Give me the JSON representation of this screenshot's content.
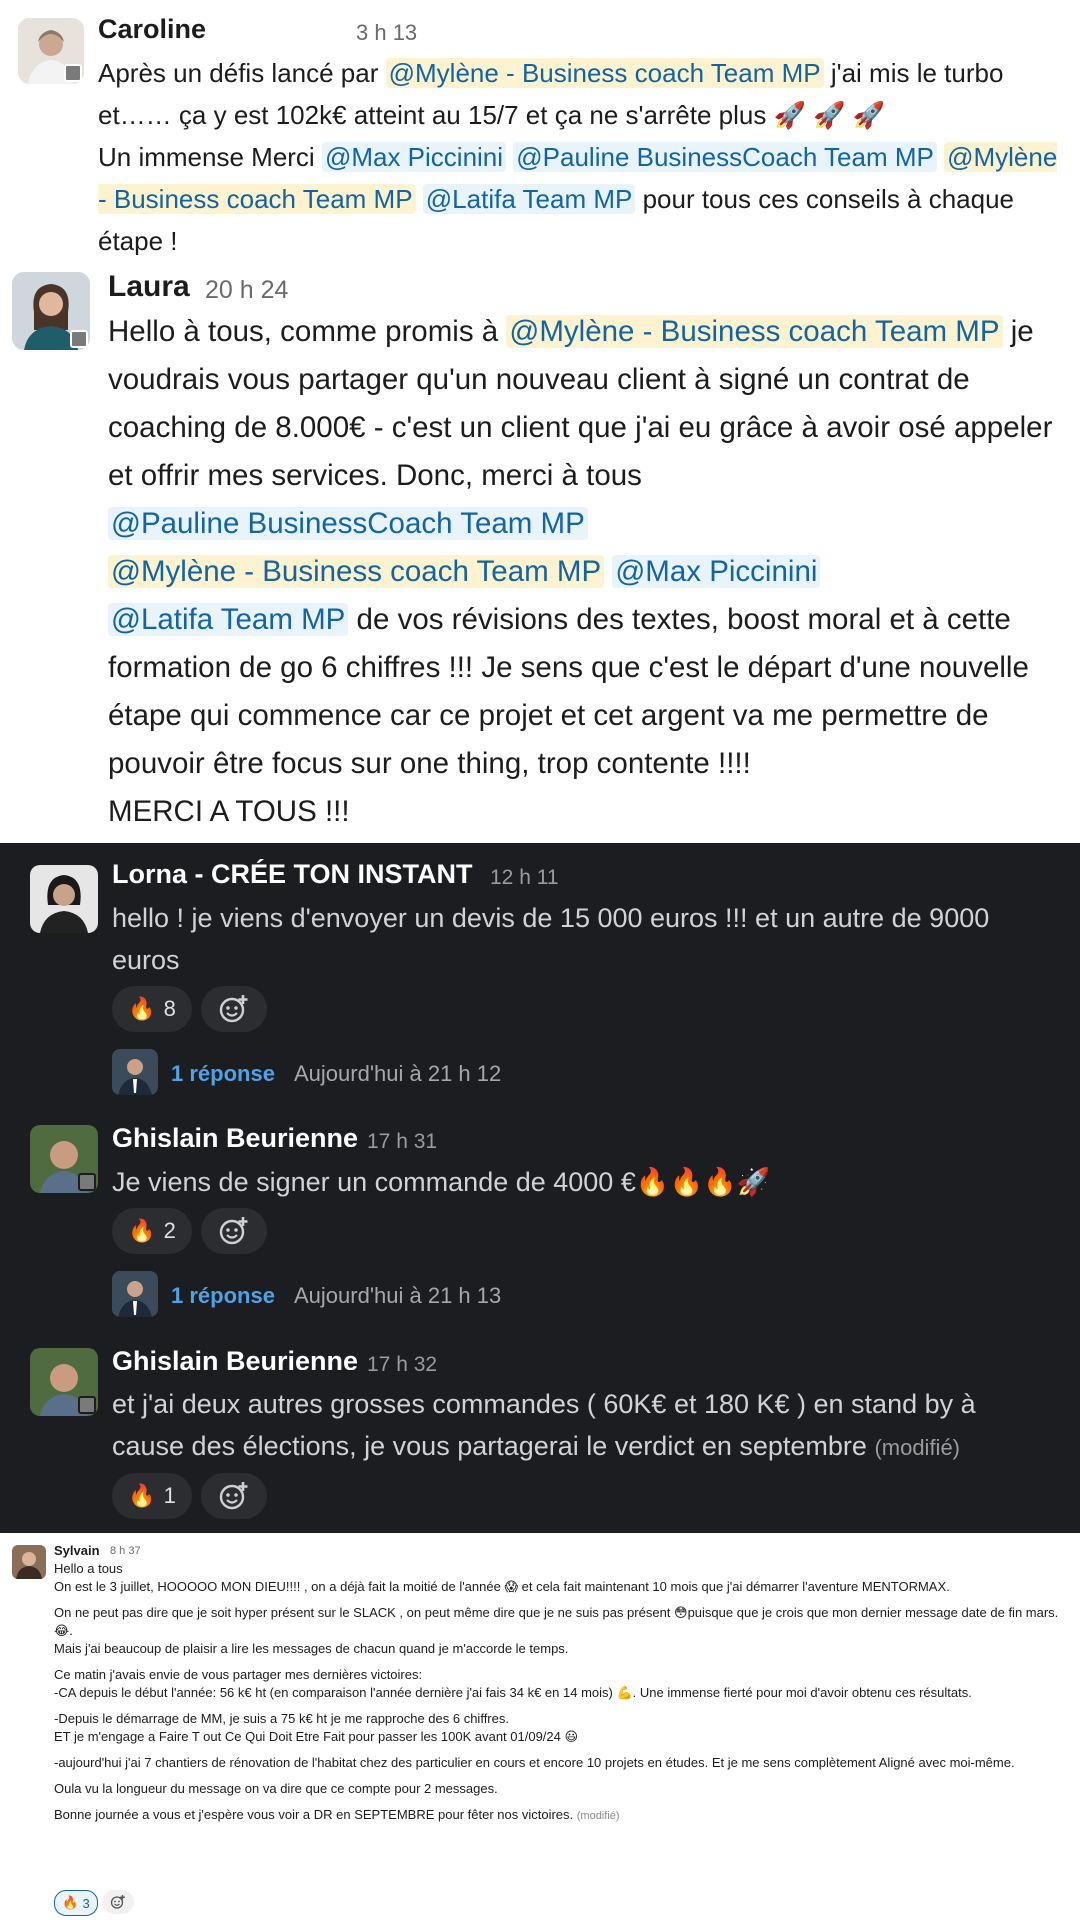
{
  "messages": {
    "caroline": {
      "name": "Caroline",
      "time": "3 h 13",
      "t1": "Après un défis lancé par ",
      "m_mylene": "@Mylène - Business coach Team MP",
      "t2": " j'ai mis le turbo et…… ça y est 102k€ atteint au 15/7 et ça ne s'arrête plus ",
      "rockets": "🚀 🚀 🚀",
      "t3": "Un immense Merci ",
      "m_max": "@Max Piccinini",
      "m_pauline": "@Pauline BusinessCoach Team MP",
      "m_mylene2": "@Mylène - Business coach Team MP",
      "m_latifa": "@Latifa Team MP",
      "t4": " pour tous ces conseils à chaque étape !"
    },
    "laura": {
      "name": "Laura",
      "time": "20 h 24",
      "t1": "Hello à tous, comme promis à ",
      "m_mylene": "@Mylène - Business coach Team MP",
      "t2": " je voudrais vous partager qu'un nouveau client à signé un contrat de coaching de 8.000€ - c'est un client que j'ai eu grâce à avoir osé appeler et offrir mes services. Donc, merci à tous",
      "m_pauline": "@Pauline BusinessCoach Team MP",
      "m_mylene2": "@Mylène - Business coach Team MP",
      "m_max": "@Max Piccinini",
      "m_latifa": "@Latifa Team MP",
      "t3": " de vos révisions des textes, boost moral et à cette formation de go 6 chiffres !!! Je sens que c'est le départ d'une nouvelle étape qui commence car ce projet et cet argent va me permettre de pouvoir être focus sur one thing, trop contente !!!!",
      "t4": "MERCI A TOUS !!!"
    },
    "lorna": {
      "name": "Lorna  - CRÉE TON INSTANT",
      "time": "12 h 11",
      "text": "hello ! je viens d'envoyer un devis de 15 000 euros !!! et un autre de 9000 euros",
      "reaction_emoji": "🔥",
      "reaction_count": "8",
      "reply_label": "1 réponse",
      "reply_time": "Aujourd'hui à 21 h 12"
    },
    "ghislain1": {
      "name": "Ghislain Beurienne",
      "time": "17 h 31",
      "text": "Je viens de signer un commande de 4000 €🔥🔥🔥🚀",
      "reaction_emoji": "🔥",
      "reaction_count": "2",
      "reply_label": "1 réponse",
      "reply_time": "Aujourd'hui à 21 h 13"
    },
    "ghislain2": {
      "name": "Ghislain Beurienne",
      "time": "17 h 32",
      "text": "et j'ai deux autres grosses commandes ( 60K€ et 180 K€ )  en stand by à cause des élections, je vous partagerai le verdict en septembre",
      "modified": "(modifié)",
      "reaction_emoji": "🔥",
      "reaction_count": "1"
    },
    "sylvain": {
      "name": "Sylvain",
      "time": "8 h 37",
      "p1": "Hello a tous",
      "p2": "On est le 3 juillet, HOOOOO MON DIEU!!!! , on a déjà fait la moitié de l'année 😱 et cela fait maintenant 10 mois que j'ai démarrer l'aventure MENTORMAX.",
      "p3": "On ne peut pas dire que je soit hyper présent sur le SLACK , on peut même dire que je ne suis pas présent 😳puisque que je crois que mon dernier message date de fin mars. 😂.",
      "p4": "Mais j'ai beaucoup de plaisir a lire les messages de chacun quand je m'accorde le temps.",
      "p5": "Ce matin j'avais envie de vous partager mes dernières victoires:",
      "p6": "-CA depuis le début l'année: 56 k€ ht (en comparaison l'année dernière j'ai fais 34 k€ en 14 mois) 💪. Une immense fierté pour moi d'avoir obtenu ces résultats.",
      "p7": "-Depuis le démarrage de MM, je suis a 75 k€ ht je me rapproche des 6 chiffres.",
      "p8": "ET je m'engage a Faire T out Ce Qui Doit Etre Fait pour passer les 100K avant 01/09/24 😃",
      "p9": "-aujourd'hui j'ai 7 chantiers de rénovation de l'habitat chez des particulier en cours et encore 10 projets en études. Et je me sens complètement Aligné avec moi-même.",
      "p10": "Oula vu la longueur du message on va dire que ce compte pour 2 messages.",
      "p11": "Bonne journée a vous et j'espère vous voir a DR en SEPTEMBRE pour fêter nos victoires.",
      "modified": "(modifié)",
      "reaction_emoji": "🔥",
      "reaction_count": "3"
    }
  },
  "colors": {
    "mention_text": "#1264a3",
    "mention_bg": "#e8f3fa",
    "mention_highlight_bg": "#fdf3d0",
    "dark_bg": "#1b1d21",
    "reply_link": "#4ea2e6"
  }
}
